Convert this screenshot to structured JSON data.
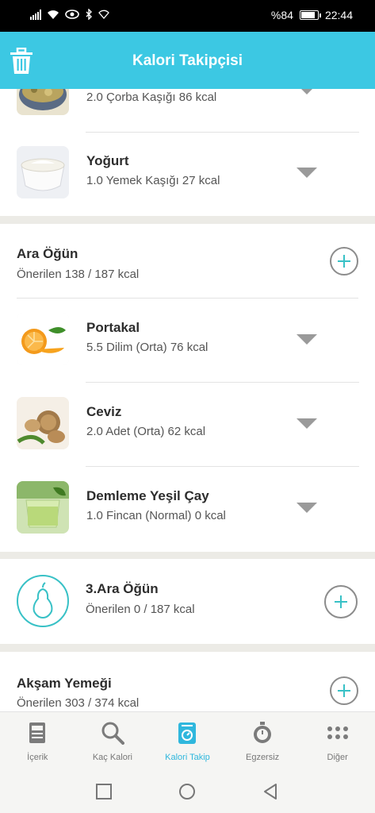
{
  "status_bar": {
    "battery_text": "%84",
    "time": "22:44",
    "battery_level": 0.84
  },
  "header": {
    "title": "Kalori Takipçisi"
  },
  "breakfast_items": [
    {
      "detail": "2.0 Çorba Kaşığı 86 kcal"
    },
    {
      "name": "Yoğurt",
      "detail": "1.0 Yemek Kaşığı 27 kcal"
    }
  ],
  "snack": {
    "title": "Ara Öğün",
    "subtitle": "Önerilen 138 / 187 kcal",
    "items": [
      {
        "name": "Portakal",
        "detail": "5.5 Dilim (Orta) 76 kcal"
      },
      {
        "name": "Ceviz",
        "detail": "2.0 Adet (Orta) 62 kcal"
      },
      {
        "name": "Demleme Yeşil Çay",
        "detail": "1.0 Fincan (Normal) 0 kcal"
      }
    ]
  },
  "snack3": {
    "title": "3.Ara Öğün",
    "subtitle": "Önerilen 0 / 187 kcal"
  },
  "dinner": {
    "title": "Akşam Yemeği",
    "subtitle": "Önerilen 303 / 374 kcal"
  },
  "bottom_nav": {
    "items": [
      {
        "label": "İçerik",
        "icon": "document-icon"
      },
      {
        "label": "Kaç Kalori",
        "icon": "search-icon"
      },
      {
        "label": "Kalori Takip",
        "icon": "scale-icon",
        "active": true
      },
      {
        "label": "Egzersiz",
        "icon": "stopwatch-icon"
      },
      {
        "label": "Diğer",
        "icon": "more-dots-icon"
      }
    ]
  },
  "colors": {
    "accent": "#3cc8e3",
    "teal": "#38c1c6",
    "active_nav": "#2fb7dd"
  }
}
